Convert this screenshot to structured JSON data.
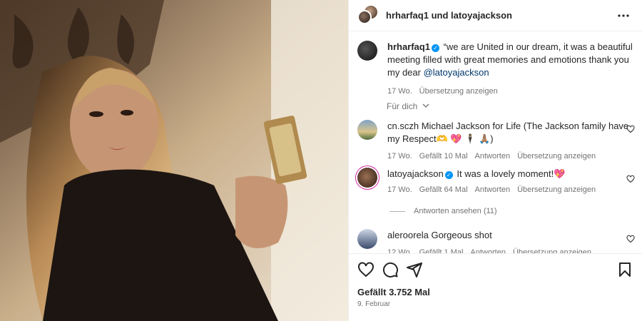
{
  "header": {
    "title": "hrharfaq1 und latoyajackson",
    "more_icon": "more-horizontal-icon"
  },
  "caption": {
    "username": "hrharfaq1",
    "text": "“we are United in our dream, it was a beautiful meeting filled with great memories and emotions thank you my dear",
    "mention": "@latoyajackson",
    "time": "17 Wo.",
    "translate": "Übersetzung anzeigen"
  },
  "sort": {
    "label": "Für dich"
  },
  "comments": [
    {
      "username": "cn.sczh",
      "text": "Michael Jackson for Life (The Jackson family have my Respect🫶 💖 🕴 🙏🏽)",
      "time": "17 Wo.",
      "likes": "Gefällt 10 Mal",
      "reply": "Antworten",
      "translate": "Übersetzung anzeigen"
    },
    {
      "username": "latoyajackson",
      "text": "It was a lovely moment!💖",
      "time": "17 Wo.",
      "likes": "Gefällt 64 Mal",
      "reply": "Antworten",
      "translate": "Übersetzung anzeigen"
    },
    {
      "username": "aleroorela",
      "text": "Gorgeous shot",
      "time": "12 Wo.",
      "likes": "Gefällt 1 Mal",
      "reply": "Antworten",
      "translate": "Übersetzung anzeigen"
    }
  ],
  "view_replies": "Antworten ansehen (11)",
  "footer": {
    "likes": "Gefällt 3.752 Mal",
    "date": "9. Februar"
  },
  "colors": {
    "verified": "#0095f6",
    "mention": "#00376b",
    "muted": "#737373"
  }
}
